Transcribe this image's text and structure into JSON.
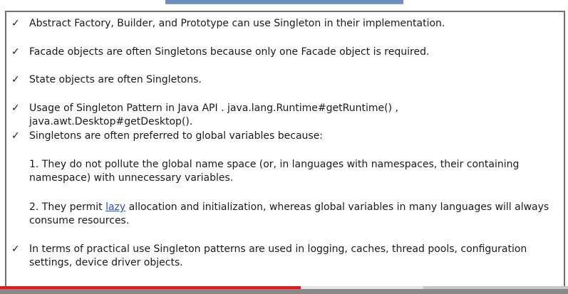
{
  "slide": {
    "bullets": [
      {
        "mark": "✓",
        "text": "Abstract Factory, Builder, and Prototype can use Singleton in their implementation."
      },
      {
        "mark": "✓",
        "text": "Facade objects are often Singletons because only one Facade object is required."
      },
      {
        "mark": "✓",
        "text": "State objects are often Singletons."
      },
      {
        "mark": "✓",
        "text": "Usage of Singleton Pattern in Java API . java.lang.Runtime#getRuntime() ,  java.awt.Desktop#getDesktop()."
      },
      {
        "mark": "✓",
        "text": "Singletons are often preferred to global variables because:"
      },
      {
        "mark": "✓",
        "text": "In terms of practical use Singleton patterns are used in logging, caches, thread pools, configuration settings, device driver objects."
      }
    ],
    "sub_points": {
      "first": "1. They do not pollute the global name space (or, in languages with namespaces, their containing namespace) with unnecessary variables.",
      "second_before_link": "2. They permit ",
      "second_link": "lazy",
      "second_after_link": " allocation and initialization, whereas global variables in many languages will always consume resources."
    }
  },
  "video_progress": {
    "played_fraction": 0.53,
    "loaded_fraction": 0.745,
    "played_color": "#e21a1a"
  }
}
